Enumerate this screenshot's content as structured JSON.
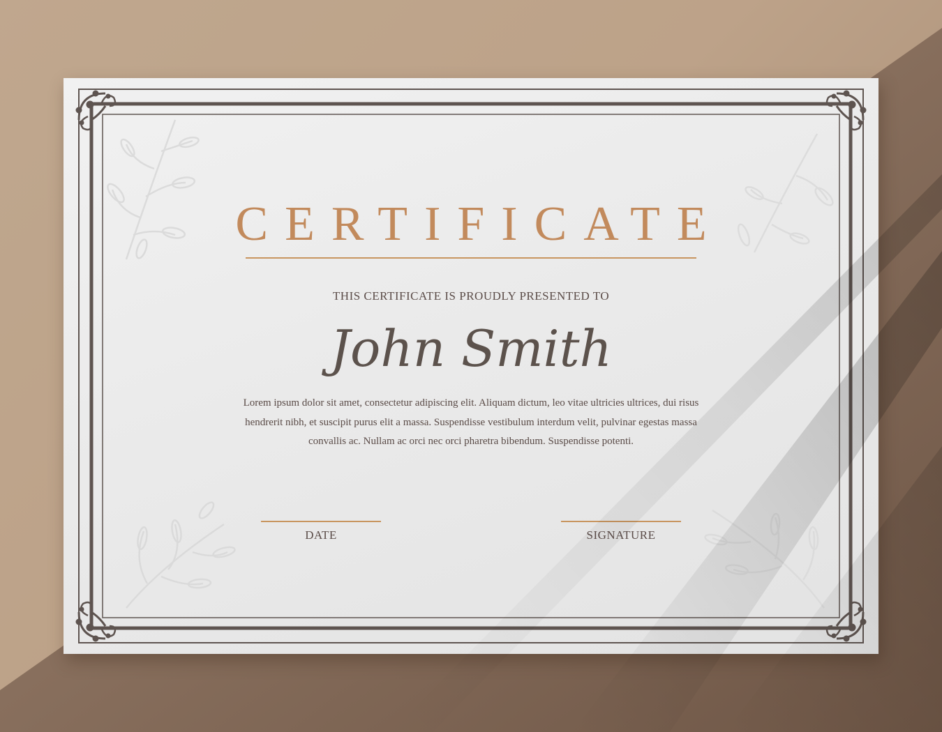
{
  "certificate": {
    "title": "CERTIFICATE",
    "subtitle": "THIS CERTIFICATE IS PROUDLY PRESENTED TO",
    "recipient": "John Smith",
    "body": "Lorem ipsum dolor sit amet, consectetur adipiscing elit. Aliquam dictum, leo vitae ultricies ultrices, dui risus hendrerit nibh, et suscipit purus elit a massa. Suspendisse vestibulum interdum velit, pulvinar egestas massa convallis ac. Nullam ac orci nec orci pharetra bibendum. Suspendisse potenti.",
    "date_label": "DATE",
    "signature_label": "SIGNATURE"
  },
  "colors": {
    "accent": "#c28a5c",
    "frame": "#5e5450",
    "text": "#5a4b47",
    "paper": "#ececec",
    "background": "#b89d84"
  },
  "icons": [
    "corner-flourish-icon",
    "leaf-branch-icon"
  ]
}
